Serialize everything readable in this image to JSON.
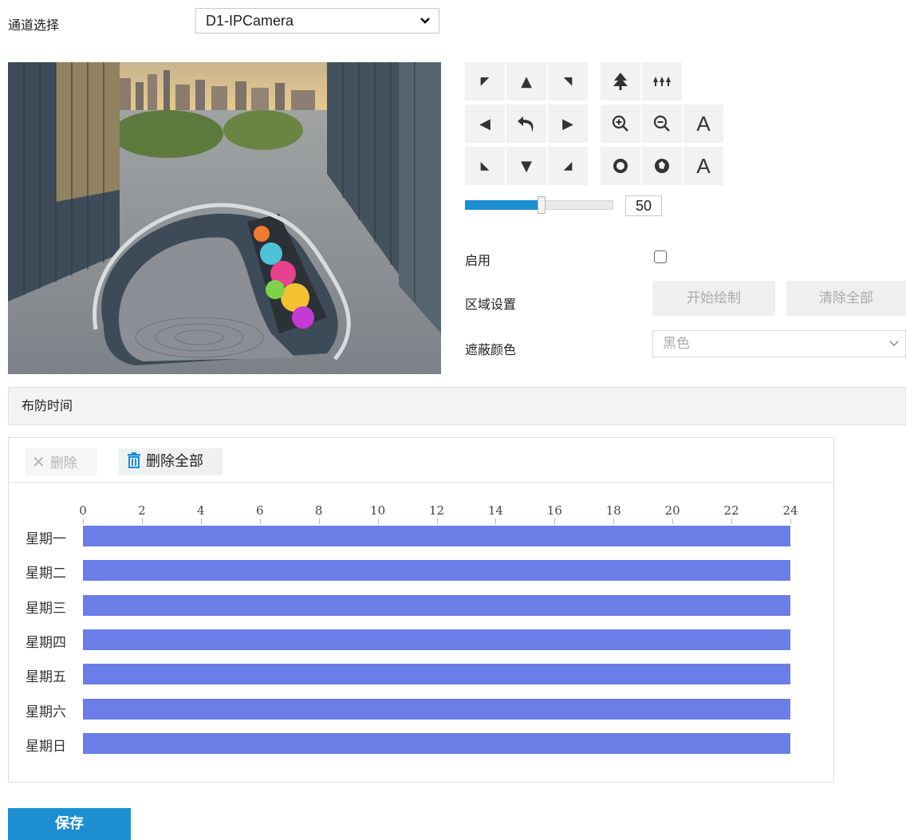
{
  "channel": {
    "label": "通道选择",
    "selected": "D1-IPCamera"
  },
  "ptz": {
    "speed_value": "50",
    "speed_fraction": 0.5,
    "iris_open_label": "A",
    "focus_auto_label": "A"
  },
  "settings": {
    "enable_label": "启用",
    "enable_checked": false,
    "region_label": "区域设置",
    "start_draw_label": "开始绘制",
    "clear_all_label": "清除全部",
    "mask_color_label": "遮蔽颜色",
    "mask_color_value": "黑色"
  },
  "schedule": {
    "section_title": "布防时间",
    "delete_label": "删除",
    "delete_all_label": "删除全部",
    "hour_ticks": [
      "0",
      "2",
      "4",
      "6",
      "8",
      "10",
      "12",
      "14",
      "16",
      "18",
      "20",
      "22",
      "24"
    ],
    "days": [
      {
        "label": "星期一",
        "start": 0,
        "end": 24
      },
      {
        "label": "星期二",
        "start": 0,
        "end": 24
      },
      {
        "label": "星期三",
        "start": 0,
        "end": 24
      },
      {
        "label": "星期四",
        "start": 0,
        "end": 24
      },
      {
        "label": "星期五",
        "start": 0,
        "end": 24
      },
      {
        "label": "星期六",
        "start": 0,
        "end": 24
      },
      {
        "label": "星期日",
        "start": 0,
        "end": 24
      }
    ],
    "bar_color": "#6b7de6"
  },
  "save_label": "保存",
  "accent_color": "#1b8fd2"
}
